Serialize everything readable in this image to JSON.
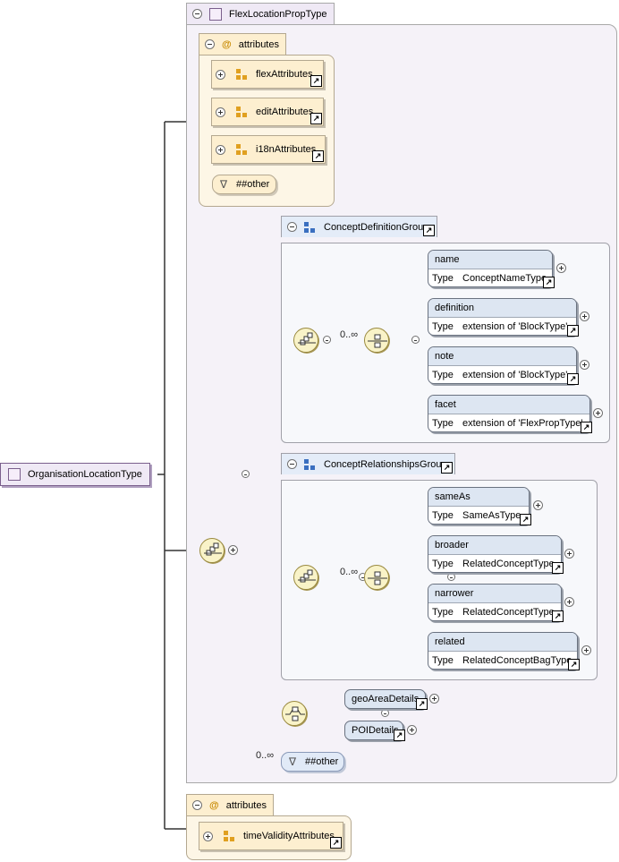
{
  "root": {
    "label": "OrganisationLocationType"
  },
  "flex_type": {
    "label": "FlexLocationPropType",
    "attributes": {
      "label": "attributes",
      "refs": [
        "flexAttributes",
        "editAttributes",
        "i18nAttributes"
      ],
      "any": "##other"
    }
  },
  "concept_definition_group": {
    "label": "ConceptDefinitionGroup",
    "occurrence": "0..∞",
    "elements": [
      {
        "name": "name",
        "type_label": "Type",
        "type": "ConceptNameType"
      },
      {
        "name": "definition",
        "type_label": "Type",
        "type": "extension of 'BlockType'"
      },
      {
        "name": "note",
        "type_label": "Type",
        "type": "extension of 'BlockType'"
      },
      {
        "name": "facet",
        "type_label": "Type",
        "type": "extension of 'FlexPropType'"
      }
    ]
  },
  "concept_relationships_group": {
    "label": "ConceptRelationshipsGroup",
    "occurrence": "0..∞",
    "elements": [
      {
        "name": "sameAs",
        "type_label": "Type",
        "type": "SameAsType"
      },
      {
        "name": "broader",
        "type_label": "Type",
        "type": "RelatedConceptType"
      },
      {
        "name": "narrower",
        "type_label": "Type",
        "type": "RelatedConceptType"
      },
      {
        "name": "related",
        "type_label": "Type",
        "type": "RelatedConceptBagType"
      }
    ]
  },
  "choice": {
    "items": [
      "geoAreaDetails",
      "POIDetails"
    ]
  },
  "any_other": {
    "occurrence": "0..∞",
    "label": "##other"
  },
  "root_attributes": {
    "label": "attributes",
    "refs": [
      "timeValidityAttributes"
    ]
  },
  "colors": {
    "lilac": "#efe9f5",
    "cream": "#fdefd0",
    "element": "#dde6f2",
    "compositor": "#f9f3c8"
  }
}
